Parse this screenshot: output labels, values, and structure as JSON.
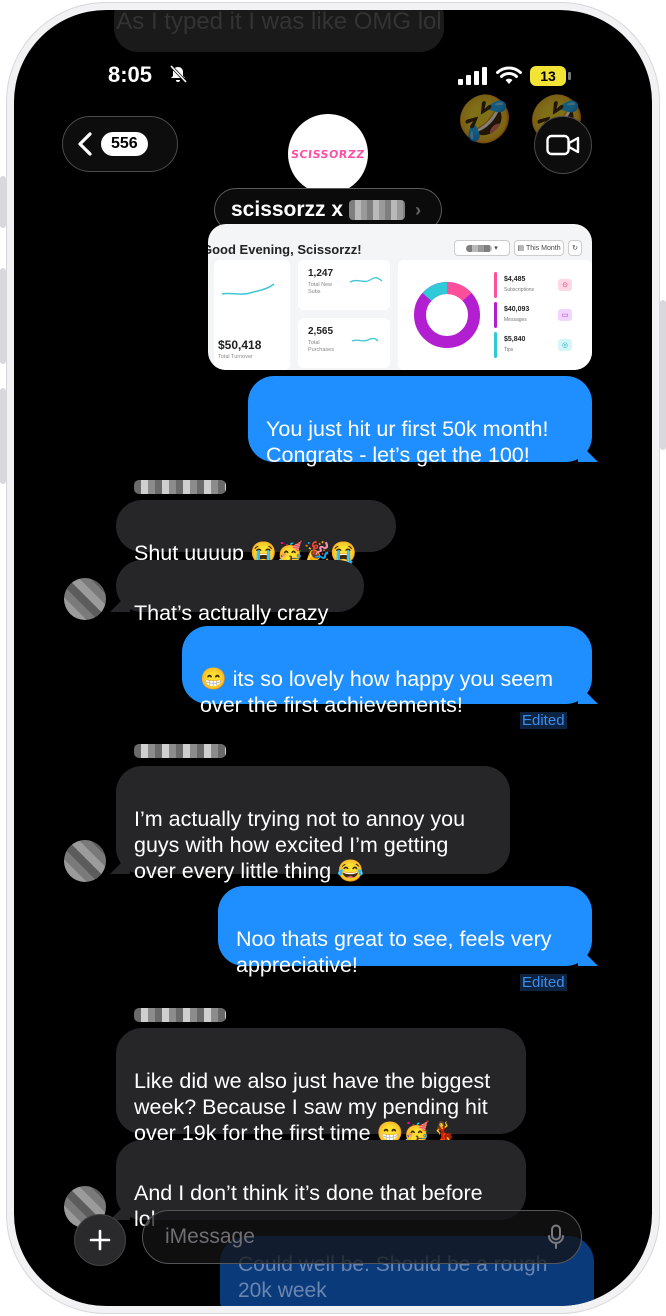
{
  "status_bar": {
    "time": "8:05",
    "battery": "13"
  },
  "header": {
    "unread_count": "556",
    "group_logo_text": "SCISSORZZ",
    "group_name": "scissorzz x"
  },
  "dashboard_image": {
    "greeting": "Good Evening, Scissorzz!",
    "period_label": "This Month",
    "total_turnover_value": "$50,418",
    "total_turnover_label": "Total Turnover",
    "new_subs_value": "1,247",
    "new_subs_label": "Total New Subs",
    "purchases_value": "2,565",
    "purchases_label": "Total Purchases",
    "subscriptions_value": "$4,485",
    "subscriptions_label": "Subscriptions",
    "messages_value": "$40,093",
    "messages_label": "Messages",
    "tips_value": "$5,840",
    "tips_label": "Tips"
  },
  "messages": [
    {
      "side": "sent",
      "text": "You just hit ur first 50k month!\nCongrats - let’s get the 100!"
    },
    {
      "side": "received",
      "text": "Shut uuuup 😭🥳🎉😭"
    },
    {
      "side": "received",
      "text": "That’s actually crazy"
    },
    {
      "side": "sent",
      "text": "😁 its so lovely how happy you seem\nover the first achievements!",
      "edited": "Edited"
    },
    {
      "side": "received",
      "text": "I’m actually trying not to annoy you\nguys with how excited I’m getting\nover every little thing 😂"
    },
    {
      "side": "sent",
      "text": "Noo thats great to see, feels very\nappreciative!",
      "edited": "Edited"
    },
    {
      "side": "received",
      "text": "Like did we also just have the biggest\nweek? Because I saw my pending hit\nover 19k for the first time 😁🥳💃"
    },
    {
      "side": "received",
      "text": "And I don’t think it’s done that before\nlol"
    }
  ],
  "background_messages": {
    "top_partial": "As I typed it I was like OMG lol",
    "bottom_partial": "Could well be. Should be a rough\n20k week"
  },
  "input": {
    "placeholder": "iMessage"
  },
  "colors": {
    "sent_bubble": "#1f8fff",
    "received_bubble": "#262628",
    "background": "#000000"
  }
}
